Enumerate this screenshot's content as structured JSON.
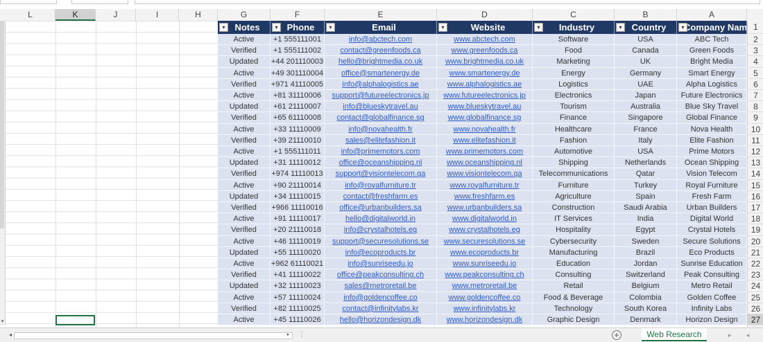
{
  "column_headers": [
    "L",
    "K",
    "J",
    "I",
    "H",
    "G",
    "F",
    "E",
    "D",
    "C",
    "B",
    "A"
  ],
  "selected_column": "K",
  "table": {
    "headers": [
      "Notes",
      "Phone",
      "Email",
      "Website",
      "Industry",
      "Country",
      "Company Name"
    ],
    "header_bg": "#1f3864",
    "row_bg": "#dde2f1",
    "link_color": "#2f5cc4",
    "rows": [
      [
        "Active",
        "+1 555111001",
        "info@abctech.com",
        "www.abctech.com",
        "Software",
        "USA",
        "ABC Tech"
      ],
      [
        "Verified",
        "+1 555111002",
        "contact@greenfoods.ca",
        "www.greenfoods.ca",
        "Food",
        "Canada",
        "Green Foods"
      ],
      [
        "Updated",
        "+44 201110003",
        "hello@brightmedia.co.uk",
        "www.brightmedia.co.uk",
        "Marketing",
        "UK",
        "Bright Media"
      ],
      [
        "Active",
        "+49 301110004",
        "office@smartenergy.de",
        "www.smartenergy.de",
        "Energy",
        "Germany",
        "Smart Energy"
      ],
      [
        "Verified",
        "+971 41110005",
        "info@alphalogistics.ae",
        "www.alphalogistics.ae",
        "Logistics",
        "UAE",
        "Alpha Logistics"
      ],
      [
        "Active",
        "+81 31110006",
        "support@futureelectronics.jp",
        "www.futureelectronics.jp",
        "Electronics",
        "Japan",
        "Future Electronics"
      ],
      [
        "Updated",
        "+61 21110007",
        "info@blueskytravel.au",
        "www.blueskytravel.au",
        "Tourism",
        "Australia",
        "Blue Sky Travel"
      ],
      [
        "Verified",
        "+65 61110008",
        "contact@globalfinance.sg",
        "www.globalfinance.sg",
        "Finance",
        "Singapore",
        "Global Finance"
      ],
      [
        "Active",
        "+33 11110009",
        "info@novahealth.fr",
        "www.novahealth.fr",
        "Healthcare",
        "France",
        "Nova Health"
      ],
      [
        "Verified",
        "+39 21110010",
        "sales@elitefashion.it",
        "www.elitefashion.it",
        "Fashion",
        "Italy",
        "Elite Fashion"
      ],
      [
        "Active",
        "+1 555111011",
        "info@primemotors.com",
        "www.primemotors.com",
        "Automotive",
        "USA",
        "Prime Motors"
      ],
      [
        "Updated",
        "+31 11110012",
        "office@oceanshipping.nl",
        "www.oceanshipping.nl",
        "Shipping",
        "Netherlands",
        "Ocean Shipping"
      ],
      [
        "Verified",
        "+974 11110013",
        "support@visiontelecom.qa",
        "www.visiontelecom.qa",
        "Telecommunications",
        "Qatar",
        "Vision Telecom"
      ],
      [
        "Active",
        "+90 21110014",
        "info@royalfurniture.tr",
        "www.royalfurniture.tr",
        "Furniture",
        "Turkey",
        "Royal Furniture"
      ],
      [
        "Updated",
        "+34 11110015",
        "contact@freshfarm.es",
        "www.freshfarm.es",
        "Agriculture",
        "Spain",
        "Fresh Farm"
      ],
      [
        "Verified",
        "+966 11110016",
        "office@urbanbuilders.sa",
        "www.urbanbuilders.sa",
        "Construction",
        "Saudi Arabia",
        "Urban Builders"
      ],
      [
        "Active",
        "+91 11110017",
        "hello@digitalworld.in",
        "www.digitalworld.in",
        "IT Services",
        "India",
        "Digital World"
      ],
      [
        "Verified",
        "+20 21110018",
        "info@crystalhotels.eg",
        "www.crystalhotels.eg",
        "Hospitality",
        "Egypt",
        "Crystal Hotels"
      ],
      [
        "Active",
        "+46 11110019",
        "support@securesolutions.se",
        "www.securesolutions.se",
        "Cybersecurity",
        "Sweden",
        "Secure Solutions"
      ],
      [
        "Updated",
        "+55 11110020",
        "info@ecoproducts.br",
        "www.ecoproducts.br",
        "Manufacturing",
        "Brazil",
        "Eco Products"
      ],
      [
        "Active",
        "+962 61110021",
        "info@sunriseedu.jo",
        "www.sunriseedu.jo",
        "Education",
        "Jordan",
        "Sunrise Education"
      ],
      [
        "Verified",
        "+41 11110022",
        "office@peakconsulting.ch",
        "www.peakconsulting.ch",
        "Consulting",
        "Switzerland",
        "Peak Consulting"
      ],
      [
        "Updated",
        "+32 11110023",
        "sales@metroretail.be",
        "www.metroretail.be",
        "Retail",
        "Belgium",
        "Metro Retail"
      ],
      [
        "Active",
        "+57 11110024",
        "info@goldencoffee.co",
        "www.goldencoffee.co",
        "Food & Beverage",
        "Colombia",
        "Golden Coffee"
      ],
      [
        "Verified",
        "+82 11110025",
        "contact@infinitylabs.kr",
        "www.infinitylabs.kr",
        "Technology",
        "South Korea",
        "Infinity Labs"
      ],
      [
        "Active",
        "+45 11110026",
        "hello@horizondesign.dk",
        "www.horizondesign.dk",
        "Graphic Design",
        "Denmark",
        "Horizon Design"
      ]
    ]
  },
  "row_numbers": [
    "1",
    "2",
    "3",
    "4",
    "5",
    "6",
    "7",
    "8",
    "9",
    "10",
    "11",
    "12",
    "13",
    "14",
    "15",
    "16",
    "17",
    "18",
    "19",
    "20",
    "21",
    "22",
    "23",
    "24",
    "25",
    "26",
    "27"
  ],
  "selected_row": "27",
  "sheet_tab": "Web Research",
  "icons": {
    "filter": "filter-dropdown-icon",
    "add_sheet": "plus-circle-icon",
    "scroll_left": "scroll-left-icon",
    "scroll_right": "scroll-right-icon"
  },
  "accent_color": "#217346"
}
